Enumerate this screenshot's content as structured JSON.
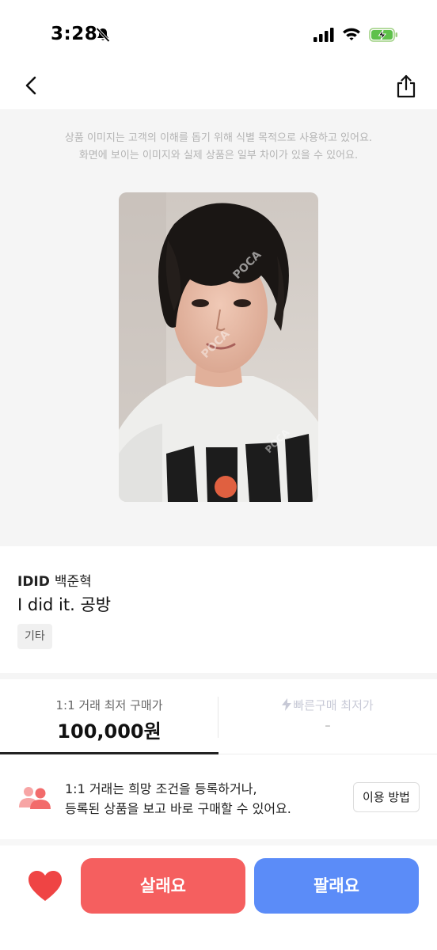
{
  "status_bar": {
    "time": "3:28",
    "icons": [
      "bell-slash-icon",
      "signal-icon",
      "wifi-icon",
      "battery-charging-icon"
    ]
  },
  "nav": {
    "back_icon": "chevron-left-icon",
    "share_icon": "share-icon"
  },
  "image_notice": {
    "line1": "상품 이미지는 고객의 이해를 돕기 위해 식별 목적으로 사용하고 있어요.",
    "line2": "화면에 보이는 이미지와 실제 상품은 일부 차이가 있을 수 있어요."
  },
  "product": {
    "group": "IDID",
    "member": "백준혁",
    "title": "I did it. 공방",
    "tag": "기타"
  },
  "price_tabs": {
    "one_to_one": {
      "label": "1:1 거래 최저 구매가",
      "value": "100,000원"
    },
    "quick": {
      "label": "빠른구매 최저가",
      "value": "-"
    }
  },
  "info": {
    "icon": "people-icon",
    "line1": "1:1 거래는 희망 조건을 등록하거나,",
    "line2": "등록된 상품을 보고 바로 구매할 수 있어요.",
    "button": "이용 방법"
  },
  "actions": {
    "heart_icon": "heart-icon",
    "buy": "살래요",
    "sell": "팔래요"
  },
  "colors": {
    "buy": "#f55f5f",
    "sell": "#5b8cf8",
    "heart": "#ef4444",
    "people_icon": "#f26b6b"
  }
}
